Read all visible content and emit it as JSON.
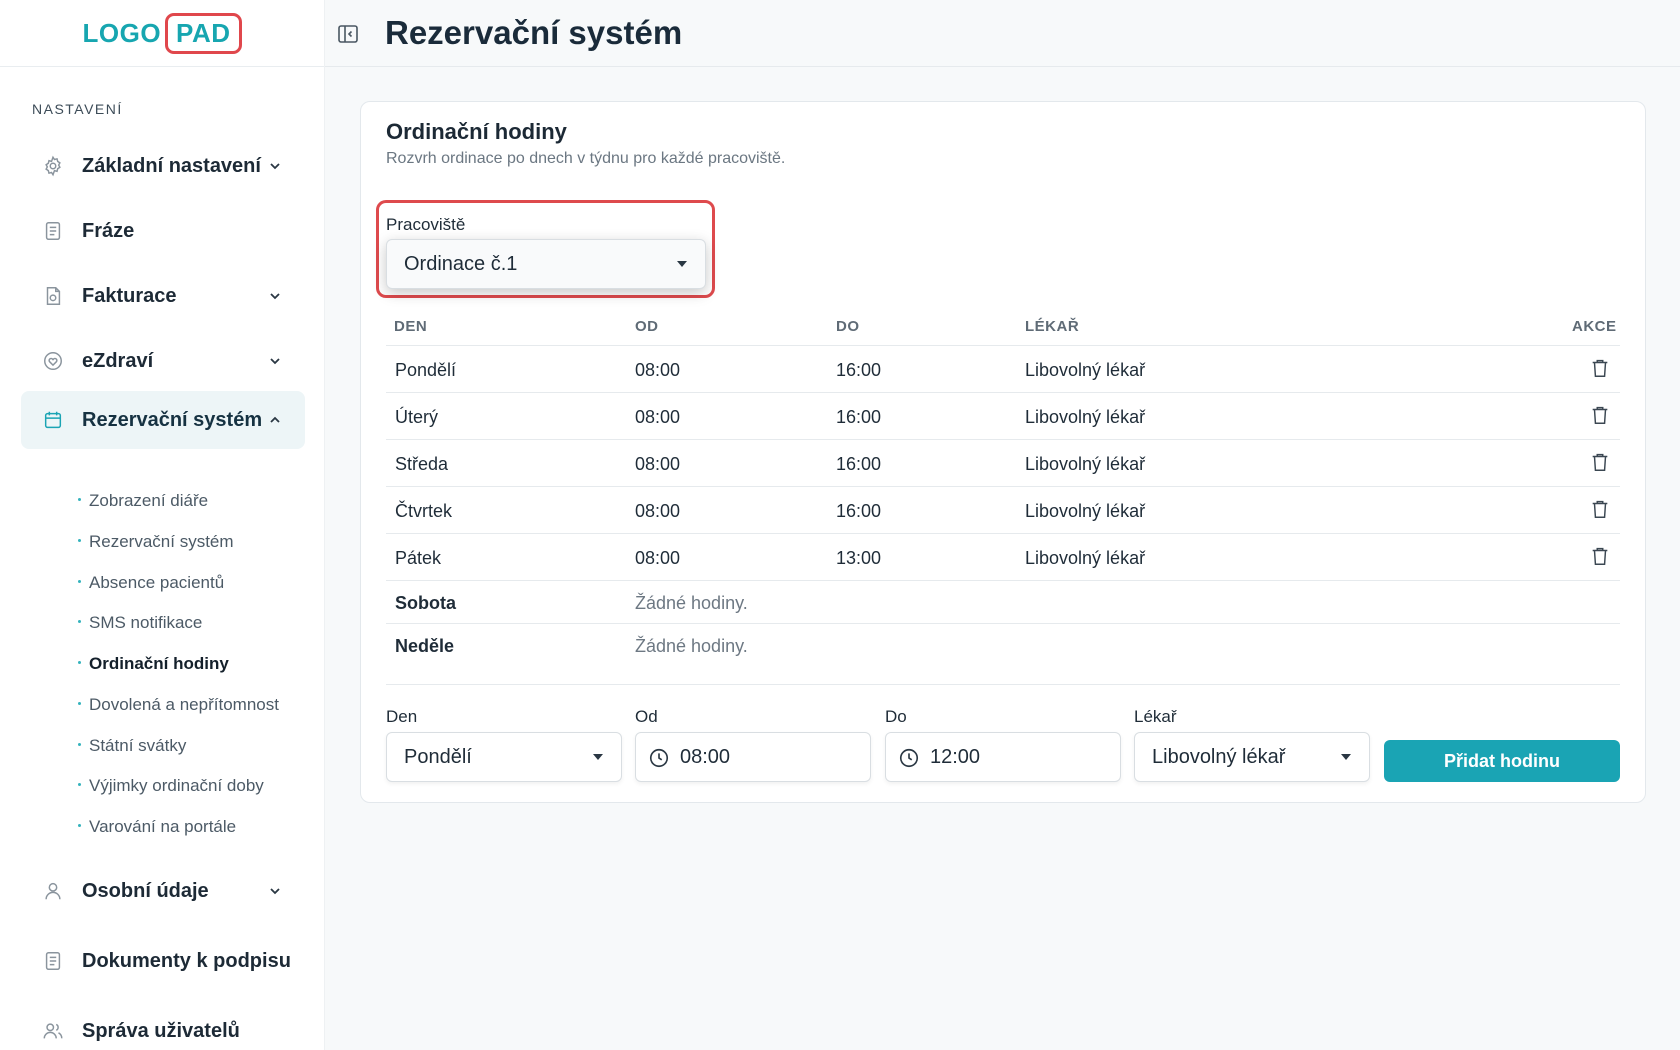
{
  "logo": {
    "part1": "LOGO",
    "part2": "PAD"
  },
  "sidebar": {
    "section_label": "NASTAVENÍ",
    "items": [
      {
        "label": "Základní nastavení",
        "icon": "gear-icon",
        "expandable": true
      },
      {
        "label": "Fráze",
        "icon": "document-icon",
        "expandable": false
      },
      {
        "label": "Fakturace",
        "icon": "invoice-icon",
        "expandable": true
      },
      {
        "label": "eZdraví",
        "icon": "heart-icon",
        "expandable": true
      },
      {
        "label": "Rezervační systém",
        "icon": "calendar-icon",
        "expandable": true,
        "active": true
      },
      {
        "label": "Osobní údaje",
        "icon": "user-icon",
        "expandable": true
      },
      {
        "label": "Dokumenty k podpisu",
        "icon": "document-icon",
        "expandable": false
      },
      {
        "label": "Správa uživatelů",
        "icon": "users-icon",
        "expandable": false
      }
    ],
    "subitems": [
      {
        "label": "Zobrazení diáře"
      },
      {
        "label": "Rezervační systém"
      },
      {
        "label": "Absence pacientů"
      },
      {
        "label": "SMS notifikace"
      },
      {
        "label": "Ordinační hodiny",
        "current": true
      },
      {
        "label": "Dovolená a nepřítomnost"
      },
      {
        "label": "Státní svátky"
      },
      {
        "label": "Výjimky ordinační doby"
      },
      {
        "label": "Varování na portále"
      }
    ]
  },
  "header": {
    "title": "Rezervační systém"
  },
  "card": {
    "title": "Ordinační hodiny",
    "subtitle": "Rozvrh ordinace po dnech v týdnu pro každé pracoviště.",
    "workplace_label": "Pracoviště",
    "workplace_value": "Ordinace č.1"
  },
  "table": {
    "headers": {
      "day": "DEN",
      "from": "OD",
      "to": "DO",
      "doctor": "LÉKAŘ",
      "actions": "AKCE"
    },
    "rows": [
      {
        "day": "Pondělí",
        "from": "08:00",
        "to": "16:00",
        "doctor": "Libovolný lékař"
      },
      {
        "day": "Úterý",
        "from": "08:00",
        "to": "16:00",
        "doctor": "Libovolný lékař"
      },
      {
        "day": "Středa",
        "from": "08:00",
        "to": "16:00",
        "doctor": "Libovolný lékař"
      },
      {
        "day": "Čtvrtek",
        "from": "08:00",
        "to": "16:00",
        "doctor": "Libovolný lékař"
      },
      {
        "day": "Pátek",
        "from": "08:00",
        "to": "13:00",
        "doctor": "Libovolný lékař"
      }
    ],
    "empty_rows": [
      {
        "day": "Sobota",
        "note": "Žádné hodiny."
      },
      {
        "day": "Neděle",
        "note": "Žádné hodiny."
      }
    ]
  },
  "form": {
    "day_label": "Den",
    "day_value": "Pondělí",
    "from_label": "Od",
    "from_value": "08:00",
    "to_label": "Do",
    "to_value": "12:00",
    "doctor_label": "Lékař",
    "doctor_value": "Libovolný lékař",
    "add_button": "Přidat hodinu"
  },
  "colors": {
    "accent": "#1aa4b4",
    "highlight": "#de4a4d",
    "active_bg": "#edf5f7"
  }
}
